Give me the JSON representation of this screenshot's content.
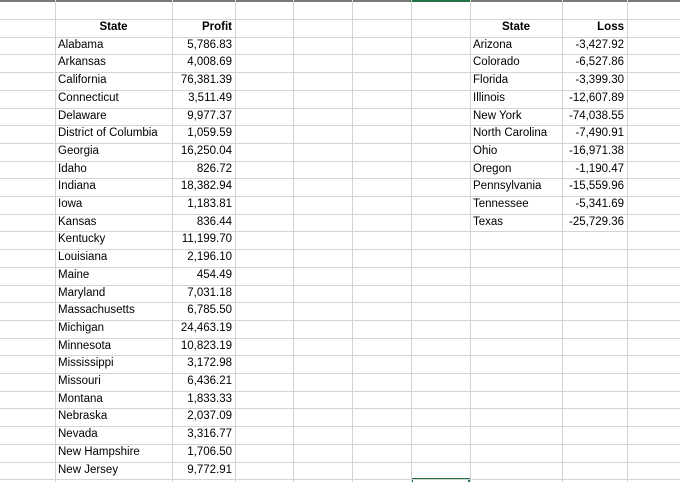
{
  "left_table": {
    "headers": {
      "state": "State",
      "profit": "Profit"
    },
    "rows": [
      {
        "state": "Alabama",
        "value": "5,786.83"
      },
      {
        "state": "Arkansas",
        "value": "4,008.69"
      },
      {
        "state": "California",
        "value": "76,381.39"
      },
      {
        "state": "Connecticut",
        "value": "3,511.49"
      },
      {
        "state": "Delaware",
        "value": "9,977.37"
      },
      {
        "state": "District of Columbia",
        "value": "1,059.59"
      },
      {
        "state": "Georgia",
        "value": "16,250.04"
      },
      {
        "state": "Idaho",
        "value": "826.72"
      },
      {
        "state": "Indiana",
        "value": "18,382.94"
      },
      {
        "state": "Iowa",
        "value": "1,183.81"
      },
      {
        "state": "Kansas",
        "value": "836.44"
      },
      {
        "state": "Kentucky",
        "value": "11,199.70"
      },
      {
        "state": "Louisiana",
        "value": "2,196.10"
      },
      {
        "state": "Maine",
        "value": "454.49"
      },
      {
        "state": "Maryland",
        "value": "7,031.18"
      },
      {
        "state": "Massachusetts",
        "value": "6,785.50"
      },
      {
        "state": "Michigan",
        "value": "24,463.19"
      },
      {
        "state": "Minnesota",
        "value": "10,823.19"
      },
      {
        "state": "Mississippi",
        "value": "3,172.98"
      },
      {
        "state": "Missouri",
        "value": "6,436.21"
      },
      {
        "state": "Montana",
        "value": "1,833.33"
      },
      {
        "state": "Nebraska",
        "value": "2,037.09"
      },
      {
        "state": "Nevada",
        "value": "3,316.77"
      },
      {
        "state": "New Hampshire",
        "value": "1,706.50"
      },
      {
        "state": "New Jersey",
        "value": "9,772.91"
      }
    ]
  },
  "right_table": {
    "headers": {
      "state": "State",
      "loss": "Loss"
    },
    "rows": [
      {
        "state": "Arizona",
        "value": "-3,427.92"
      },
      {
        "state": "Colorado",
        "value": "-6,527.86"
      },
      {
        "state": "Florida",
        "value": "-3,399.30"
      },
      {
        "state": "Illinois",
        "value": "-12,607.89"
      },
      {
        "state": "New York",
        "value": "-74,038.55"
      },
      {
        "state": "North Carolina",
        "value": "-7,490.91"
      },
      {
        "state": "Ohio",
        "value": "-16,971.38"
      },
      {
        "state": "Oregon",
        "value": "-1,190.47"
      },
      {
        "state": "Pennsylvania",
        "value": "-15,559.96"
      },
      {
        "state": "Tennessee",
        "value": "-5,341.69"
      },
      {
        "state": "Texas",
        "value": "-25,729.36"
      }
    ]
  }
}
